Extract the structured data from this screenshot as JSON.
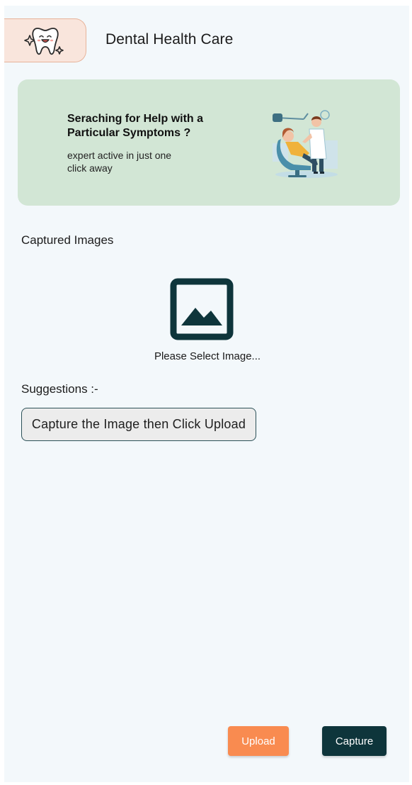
{
  "header": {
    "title": "Dental Health Care",
    "logo_icon": "tooth-icon"
  },
  "banner": {
    "title": "Seraching for Help with a Particular Symptoms ?",
    "subtitle": "expert active in just one click away",
    "illustration": "dentist-illustration"
  },
  "captured": {
    "label": "Captured Images",
    "placeholder_icon": "image-placeholder-icon",
    "select_text": "Please Select Image..."
  },
  "suggestions": {
    "label": "Suggestions :-",
    "text": "Capture the Image then Click Upload"
  },
  "actions": {
    "upload_label": "Upload",
    "capture_label": "Capture"
  },
  "colors": {
    "background": "#f3f8fb",
    "banner": "#d2e6d5",
    "logo_bg": "#f9e5dc",
    "upload": "#f98b50",
    "capture": "#0e353b",
    "icon_dark": "#0e353b"
  }
}
